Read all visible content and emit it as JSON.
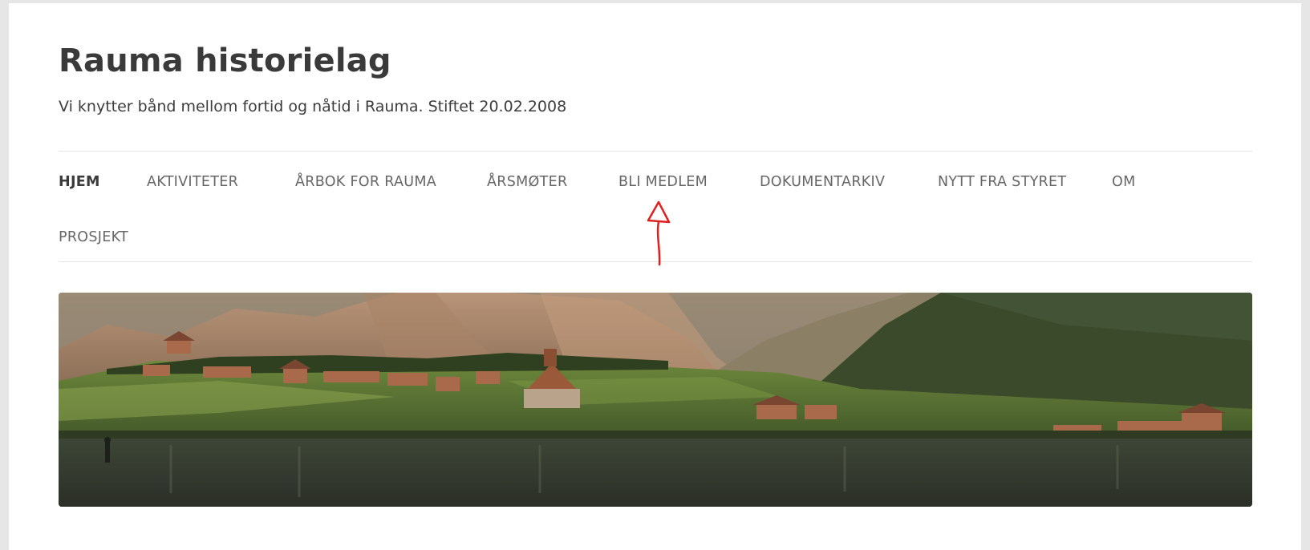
{
  "site": {
    "title": "Rauma historielag",
    "description": "Vi knytter bånd mellom fortid og nåtid i Rauma. Stiftet 20.02.2008"
  },
  "nav": {
    "items": [
      {
        "label": "HJEM",
        "active": true
      },
      {
        "label": "AKTIVITETER"
      },
      {
        "label": "ÅRBOK FOR RAUMA"
      },
      {
        "label": "ÅRSMØTER"
      },
      {
        "label": "BLI MEDLEM"
      },
      {
        "label": "DOKUMENTARKIV"
      },
      {
        "label": "NYTT FRA STYRET"
      },
      {
        "label": "OM"
      },
      {
        "label": "PROSJEKT"
      }
    ]
  },
  "header_image": {
    "subject": "historical-fjord-village-landscape"
  },
  "annotation": {
    "color": "#e02020",
    "icon": "red-arrow-up-annotation"
  }
}
